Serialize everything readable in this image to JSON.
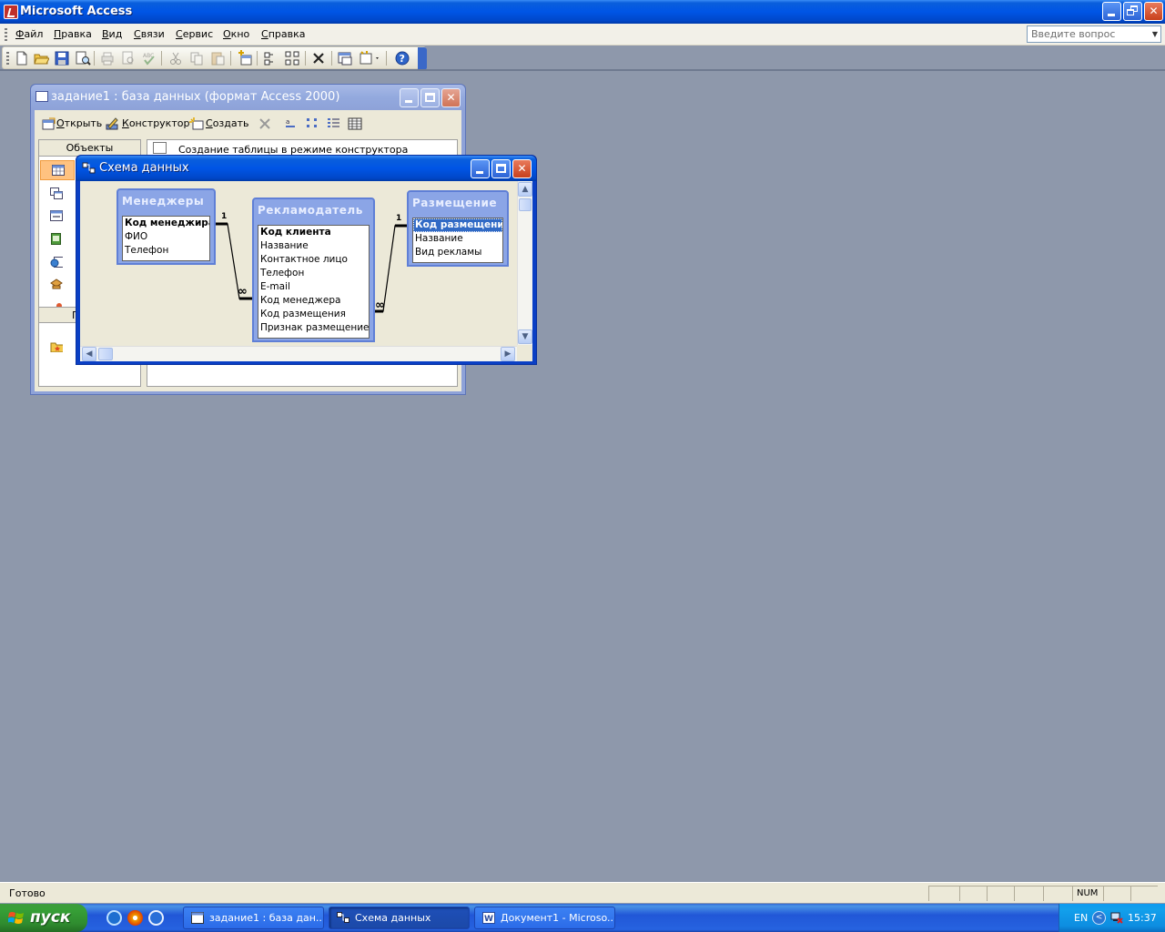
{
  "app": {
    "title": "Microsoft Access",
    "menus": [
      {
        "label": "Файл",
        "u": "Ф",
        "rest": "айл"
      },
      {
        "label": "Правка",
        "u": "П",
        "rest": "равка"
      },
      {
        "label": "Вид",
        "u": "В",
        "rest": "ид"
      },
      {
        "label": "Связи",
        "u": "С",
        "rest": "вязи"
      },
      {
        "label": "Сервис",
        "u": "С",
        "rest": "ервис"
      },
      {
        "label": "Окно",
        "u": "О",
        "rest": "кно"
      },
      {
        "label": "Справка",
        "u": "С",
        "rest": "правка"
      }
    ],
    "help_placeholder": "Введите вопрос"
  },
  "db_window": {
    "title": "задание1 : база данных (формат Access 2000)",
    "toolbar": {
      "open": {
        "u": "О",
        "rest": "ткрыть"
      },
      "design": {
        "u": "К",
        "rest": "онструктор"
      },
      "create": {
        "u": "С",
        "rest": "оздать"
      }
    },
    "objects_header": "Объекты",
    "groups_header": "Г",
    "list_first_row": "Создание таблицы в режиме конструктора"
  },
  "schema_window": {
    "title": "Схема данных",
    "tables": [
      {
        "name": "Менеджеры",
        "fields": [
          "Код менеджира",
          "ФИО",
          "Телефон"
        ],
        "pk": 0
      },
      {
        "name": "Рекламодатель",
        "fields": [
          "Код клиента",
          "Название",
          "Контактное лицо",
          "Телефон",
          "E-mail",
          "Код менеджера",
          "Код размещения",
          "Признак размещение"
        ],
        "pk": 0
      },
      {
        "name": "Размещение",
        "fields": [
          "Код размещение",
          "Название",
          "Вид рекламы"
        ],
        "pk": 0,
        "selected": 0
      }
    ],
    "relations": [
      {
        "from": "Менеджеры.Код менеджира",
        "to": "Рекламодатель.Код менеджера",
        "one": "1",
        "many": "∞"
      },
      {
        "from": "Размещение.Код размещение",
        "to": "Рекламодатель.Код размещения",
        "one": "1",
        "many": "∞"
      }
    ]
  },
  "statusbar": {
    "text": "Готово",
    "indicator": "NUM"
  },
  "taskbar": {
    "start_label": "пуск",
    "tasks": [
      {
        "label": "задание1 : база дан...",
        "active": false
      },
      {
        "label": "Схема данных",
        "active": true
      },
      {
        "label": "Документ1 - Microso...",
        "active": false
      }
    ],
    "language": "EN",
    "clock": "15:37"
  },
  "colors": {
    "titlebar_active": "#0055e5",
    "titlebar_inactive": "#8ea2d8",
    "desktop_workspace": "#8e98ab",
    "taskbar": "#2457d6",
    "start_button": "#37a037",
    "selection": "#316ac5"
  }
}
